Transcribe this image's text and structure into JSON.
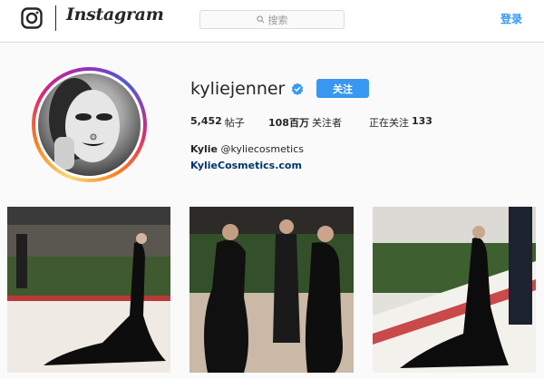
{
  "nav": {
    "logo_icon": "instagram-camera-icon",
    "wordmark": "Instagram",
    "search_placeholder": "搜索",
    "search_icon": "search-icon",
    "login_label": "登录"
  },
  "profile": {
    "username": "kyliejenner",
    "verified_icon": "verified-badge-icon",
    "follow_label": "关注",
    "stats": {
      "posts_count": "5,452",
      "posts_label": "帖子",
      "followers_count": "108百万",
      "followers_label": "关注者",
      "following_label": "正在关注",
      "following_count": "133"
    },
    "full_name": "Kylie",
    "bio_handle": "@kyliecosmetics",
    "website": "KylieCosmetics.com"
  },
  "colors": {
    "accent": "#3897f0",
    "link": "#003569",
    "text": "#262626",
    "background": "#fafafa"
  }
}
